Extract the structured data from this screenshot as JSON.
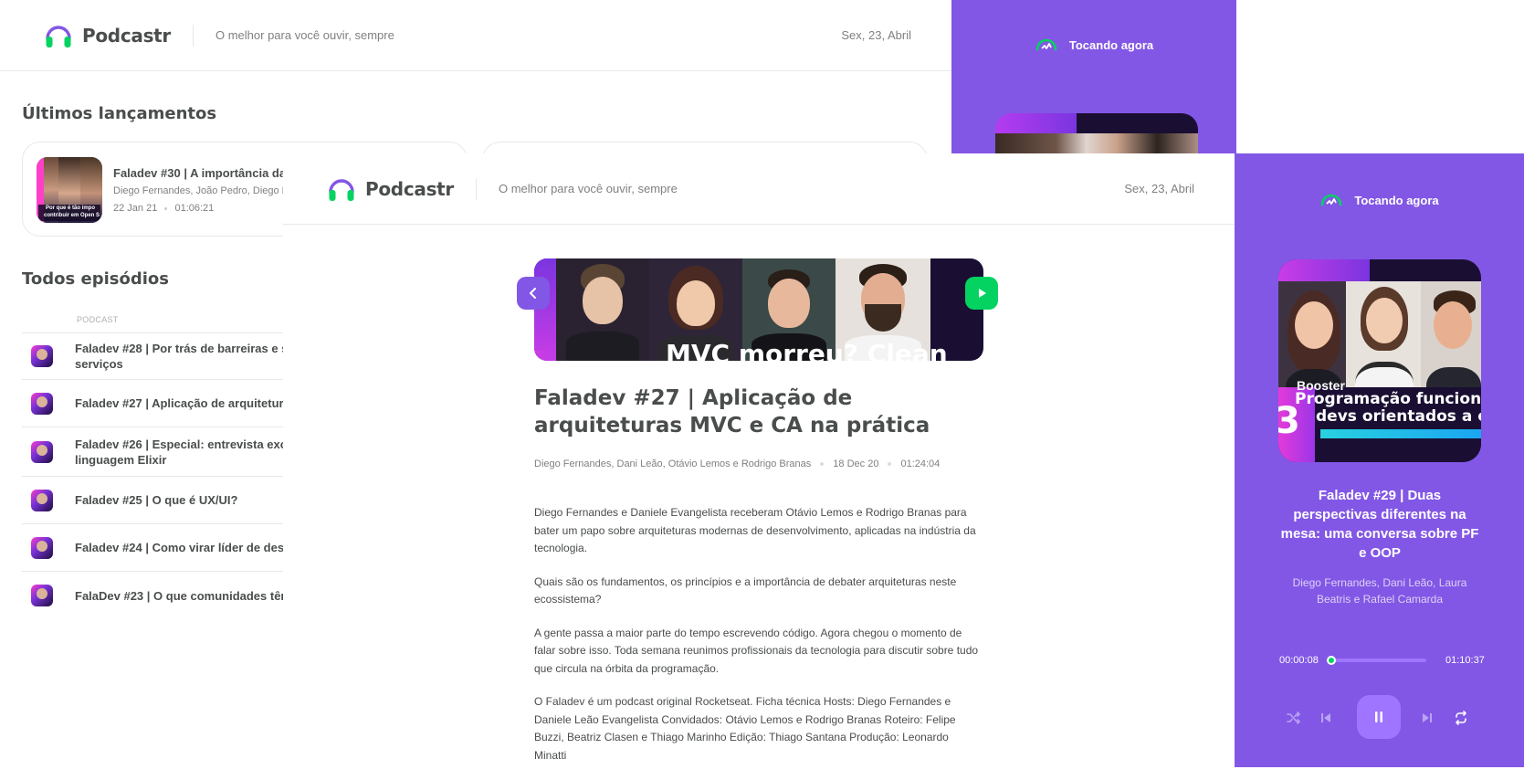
{
  "app": {
    "name": "Podcastr",
    "tagline": "O melhor para você ouvir, sempre",
    "date": "Sex, 23, Abril"
  },
  "colors": {
    "purple": "#8257e5",
    "green": "#04d361",
    "text": "#494d4b",
    "muted": "#808080",
    "border": "#e6e8eb"
  },
  "home": {
    "latest_title": "Últimos lançamentos",
    "latest": [
      {
        "title": "Faladev #30 | A importância da",
        "members": "Diego Fernandes, João Pedro, Diego F",
        "date": "22 Jan 21",
        "duration": "01:06:21",
        "thumb_caption_1": "Por que é tão impo",
        "thumb_caption_2": "contribuir em Open S"
      }
    ],
    "all_title": "Todos episódios",
    "table_header": "PODCAST",
    "episodes": [
      {
        "title": "Faladev #28 | Por trás de barreiras e s",
        "title_line2": "serviços"
      },
      {
        "title": "Faladev #27 | Aplicação de arquitetur",
        "title_line2": ""
      },
      {
        "title": "Faladev #26 | Especial: entrevista excl",
        "title_line2": "linguagem Elixir"
      },
      {
        "title": "Faladev #25 | O que é UX/UI?",
        "title_line2": ""
      },
      {
        "title": "Faladev #24 | Como virar líder de des",
        "title_line2": ""
      },
      {
        "title": "FalaDev #23 | O que comunidades têm",
        "title_line2": ""
      }
    ]
  },
  "player_back": {
    "label": "Tocando agora"
  },
  "episode": {
    "cover_text": "MVC morreu? Clean",
    "title": "Faladev #27 | Aplicação de arquiteturas MVC e CA na prática",
    "members": "Diego Fernandes, Dani Leão, Otávio Lemos e Rodrigo Branas",
    "date": "18 Dec 20",
    "duration": "01:24:04",
    "description": [
      "Diego Fernandes e Daniele Evangelista receberam Otávio Lemos e Rodrigo Branas para bater um papo sobre arquiteturas modernas de desenvolvimento, aplicadas na indústria da tecnologia.",
      "Quais são os fundamentos, os princípios e a importância de debater arquiteturas neste ecossistema?",
      "A gente passa a maior parte do tempo escrevendo código. Agora chegou o momento de falar sobre isso. Toda semana reunimos profissionais da tecnologia para discutir sobre tudo que circula na órbita da programação.",
      "O Faladev é um podcast original Rocketseat.  Ficha técnica Hosts: Diego Fernandes e Daniele Leão Evangelista Convidados: Otávio Lemos  e Rodrigo Branas Roteiro: Felipe Buzzi, Beatriz Clasen e Thiago Marinho Edição: Thiago Santana Produção: Leonardo Minatti"
    ]
  },
  "player": {
    "label": "Tocando agora",
    "cover_number": "3",
    "cover_logo": "Booster",
    "cover_text_1": "Programação funcion",
    "cover_text_2": "devs orientados a o",
    "title": "Faladev #29 | Duas perspectivas diferentes na mesa: uma conversa sobre PF e OOP",
    "members": "Diego Fernandes, Dani Leão, Laura Beatris e Rafael Camarda",
    "current_time": "00:00:08",
    "total_time": "01:10:37",
    "progress": 0.02,
    "icons": [
      "shuffle-icon",
      "play-previous-icon",
      "pause-icon",
      "play-next-icon",
      "repeat-icon"
    ]
  }
}
